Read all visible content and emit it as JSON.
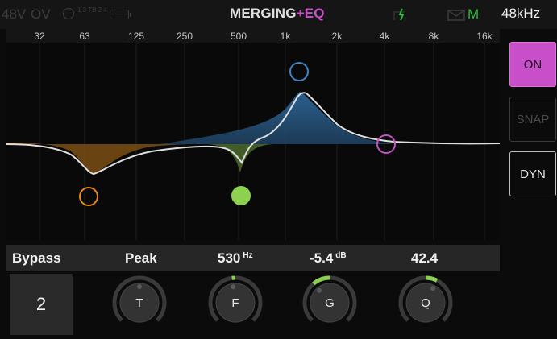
{
  "status_bar": {
    "phantom_label": "48V",
    "overload_label": "OV",
    "routing_text": "1 3 TB 2 4",
    "title_brand": "MERGING",
    "title_suffix": "+EQ",
    "monitor_flag": "M",
    "sample_rate": "48kHz"
  },
  "frequency_axis": [
    "32",
    "63",
    "125",
    "250",
    "500",
    "1k",
    "2k",
    "4k",
    "8k",
    "16k"
  ],
  "side_buttons": {
    "on": "ON",
    "snap": "SNAP",
    "dyn": "DYN"
  },
  "params": {
    "bypass": "Bypass",
    "type": "Peak",
    "frequency_value": "530",
    "frequency_unit": "Hz",
    "gain_value": "-5.4",
    "gain_unit": "dB",
    "q_value": "42.4"
  },
  "band_number": "2",
  "knobs": [
    {
      "label": "T",
      "level": 0.5
    },
    {
      "label": "F",
      "level": 0.47
    },
    {
      "label": "G",
      "level": 0.35
    },
    {
      "label": "Q",
      "level": 0.6
    }
  ],
  "colors": {
    "accent": "#c84fc9",
    "knob_active": "#8ed14f",
    "band1": "#e28a1c",
    "band2": "#8ed14f",
    "band3": "#3a86c8",
    "band4": "#c84fc9",
    "curve": "#e0e0e0"
  }
}
